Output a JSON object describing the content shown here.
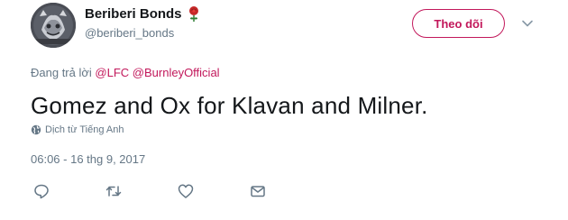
{
  "user": {
    "display_name": "Beriberi Bonds",
    "handle": "@beriberi_bonds",
    "badge_icon": "rose-icon",
    "avatar_icon": "avatar-image"
  },
  "follow_button": {
    "label": "Theo dõi",
    "accent": "#c2185b"
  },
  "more_menu": {
    "icon": "chevron-down-icon"
  },
  "reply": {
    "prefix": "Đang trả lời",
    "mentions": [
      "@LFC",
      "@BurnleyOfficial"
    ]
  },
  "tweet": {
    "text": "Gomez and Ox for Klavan and Milner.",
    "translate_label": "Dịch từ Tiếng Anh",
    "timestamp": "06:06 - 16 thg 9, 2017"
  },
  "actions": [
    {
      "name": "reply-icon"
    },
    {
      "name": "retweet-icon"
    },
    {
      "name": "like-icon"
    },
    {
      "name": "message-icon"
    }
  ],
  "colors": {
    "text": "#14171a",
    "secondary": "#657786",
    "accent": "#c2185b"
  }
}
